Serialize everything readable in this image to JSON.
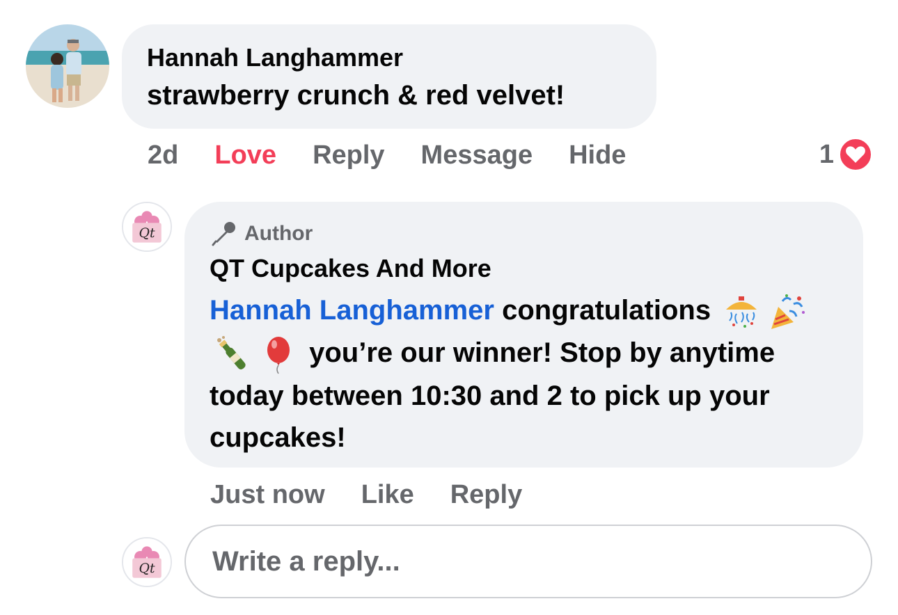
{
  "comment": {
    "author": "Hannah Langhammer",
    "text": "strawberry crunch & red velvet!",
    "time": "2d",
    "actions": {
      "love": "Love",
      "reply": "Reply",
      "message": "Message",
      "hide": "Hide"
    },
    "reaction_count": "1",
    "reaction_icon": "heart-reaction-icon",
    "reaction_color": "#f33e58"
  },
  "reply": {
    "badge": "Author",
    "badge_icon": "microphone-icon",
    "author": "QT Cupcakes And More",
    "mention": "Hannah Langhammer",
    "text_part1": " congratulations ",
    "text_part2": " you’re our winner! Stop by anytime today between 10:30 and 2 to pick up your cupcakes!",
    "emojis": [
      "confetti-ball-icon",
      "party-popper-icon",
      "champagne-bottle-icon",
      "balloon-icon"
    ],
    "time": "Just now",
    "actions": {
      "like": "Like",
      "reply": "Reply"
    },
    "mention_color": "#1760d6"
  },
  "reply_box": {
    "placeholder": "Write a reply..."
  },
  "avatars": {
    "commenter": "Hannah Langhammer profile photo",
    "page": "QT Cupcakes logo"
  },
  "logo_text": "Qt",
  "colors": {
    "bubble": "#f0f2f5",
    "secondary_text": "#65676b",
    "primary_text": "#050505"
  }
}
